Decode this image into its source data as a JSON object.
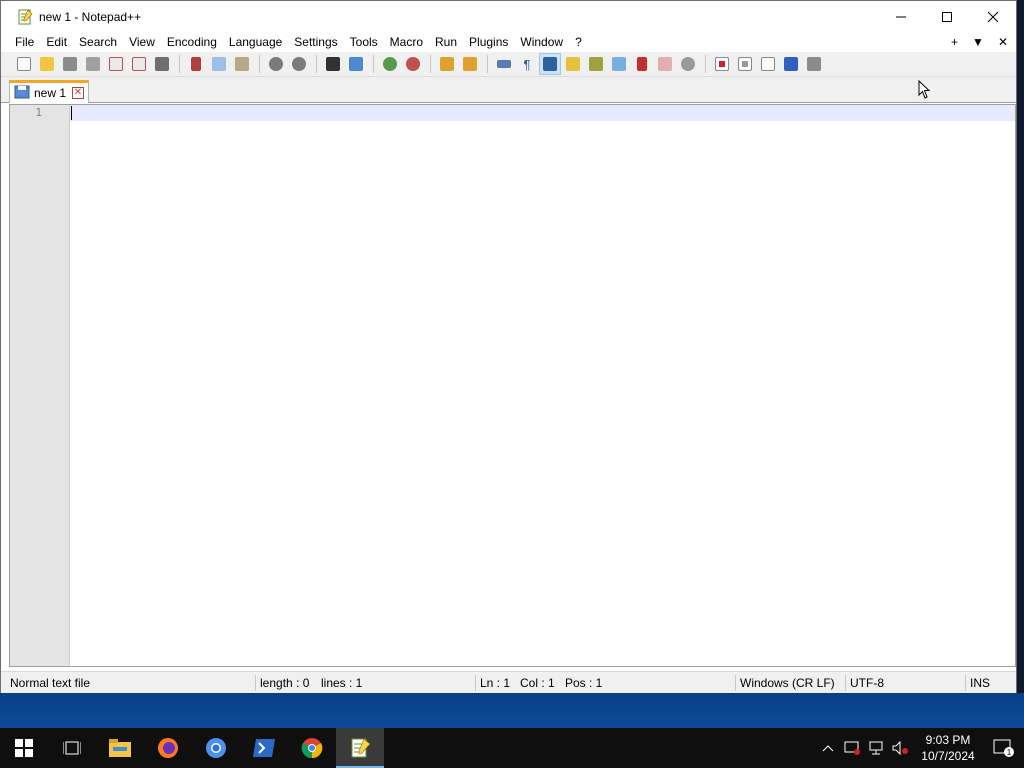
{
  "window": {
    "title": "new 1 - Notepad++",
    "minimize_glyph": "—",
    "maximize_glyph": "☐",
    "close_glyph": "✕"
  },
  "menu": {
    "items": [
      {
        "label": "File",
        "name": "menu-file"
      },
      {
        "label": "Edit",
        "name": "menu-edit"
      },
      {
        "label": "Search",
        "name": "menu-search"
      },
      {
        "label": "View",
        "name": "menu-view"
      },
      {
        "label": "Encoding",
        "name": "menu-encoding"
      },
      {
        "label": "Language",
        "name": "menu-language"
      },
      {
        "label": "Settings",
        "name": "menu-settings"
      },
      {
        "label": "Tools",
        "name": "menu-tools"
      },
      {
        "label": "Macro",
        "name": "menu-macro"
      },
      {
        "label": "Run",
        "name": "menu-run"
      },
      {
        "label": "Plugins",
        "name": "menu-plugins"
      },
      {
        "label": "Window",
        "name": "menu-window"
      },
      {
        "label": "?",
        "name": "menu-help"
      }
    ],
    "right": {
      "add": "+",
      "dropdown": "▼",
      "close": "✕"
    }
  },
  "toolbar": {
    "icons": [
      "new-file-icon",
      "open-file-icon",
      "save-icon",
      "save-all-icon",
      "close-icon",
      "close-all-icon",
      "print-icon",
      "cut-icon",
      "copy-icon",
      "paste-icon",
      "undo-icon",
      "redo-icon",
      "find-icon",
      "replace-icon",
      "zoom-in-icon",
      "zoom-out-icon",
      "sync-vertical-icon",
      "sync-horizontal-icon",
      "word-wrap-icon",
      "show-all-characters-icon",
      "indent-guide-icon",
      "user-defined-language-icon",
      "document-map-icon",
      "document-list-icon",
      "function-list-icon",
      "folder-as-workspace-icon",
      "monitoring-icon",
      "record-macro-icon",
      "stop-recording-icon",
      "playback-macro-icon",
      "run-macro-multiple-icon",
      "save-macro-icon"
    ]
  },
  "tabs": [
    {
      "label": "new 1",
      "close": "✕"
    }
  ],
  "editor": {
    "line_numbers": [
      "1"
    ],
    "content": ""
  },
  "statusbar": {
    "file_type": "Normal text file",
    "length": "length : 0",
    "lines": "lines : 1",
    "ln": "Ln : 1",
    "col": "Col : 1",
    "pos": "Pos : 1",
    "eol": "Windows (CR LF)",
    "encoding": "UTF-8",
    "mode": "INS"
  },
  "taskbar": {
    "apps": [
      "start-icon",
      "task-view-icon",
      "file-explorer-icon",
      "firefox-icon",
      "chromium-icon",
      "powershell-icon",
      "chrome-icon",
      "notepadpp-icon"
    ],
    "time": "9:03 PM",
    "date": "10/7/2024",
    "notification_count": "1"
  },
  "colors": {
    "accent_tab": "#f5a623",
    "current_line": "#e8e8ff",
    "taskbar": "#0f0f0f"
  }
}
